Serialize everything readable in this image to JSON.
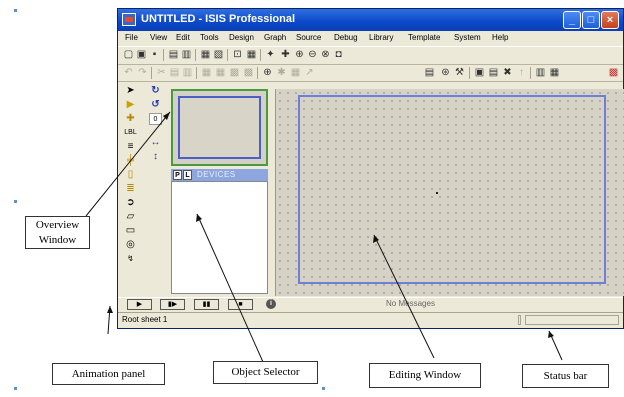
{
  "window": {
    "title": "UNTITLED - ISIS Professional",
    "controls": [
      "minimize-icon",
      "maximize-icon",
      "close-icon"
    ]
  },
  "menubar": [
    "File",
    "View",
    "Edit",
    "Tools",
    "Design",
    "Graph",
    "Source",
    "Debug",
    "Library",
    "Template",
    "System",
    "Help"
  ],
  "object_selector": {
    "p_button": "P",
    "l_button": "L",
    "header_label": "DEVICES"
  },
  "animation_panel": {
    "buttons": [
      "play-icon",
      "step-icon",
      "pause-icon",
      "stop-icon"
    ],
    "play": "▶",
    "step": "▮▶",
    "pause": "▮▮",
    "stop": "■",
    "messages": "No Messages"
  },
  "status_bar": {
    "text": "Root sheet 1"
  },
  "callouts": {
    "overview": [
      "Overview",
      "Window"
    ],
    "animation": "Animation panel",
    "object_selector": "Object Selector",
    "editing": "Editing Window",
    "status": "Status bar"
  },
  "colors": {
    "titlebar": "#0c48c8",
    "overview_border": "#4a9a3f",
    "sheet_border": "#6d7fd6",
    "devices_header": "#8ea6e0"
  }
}
